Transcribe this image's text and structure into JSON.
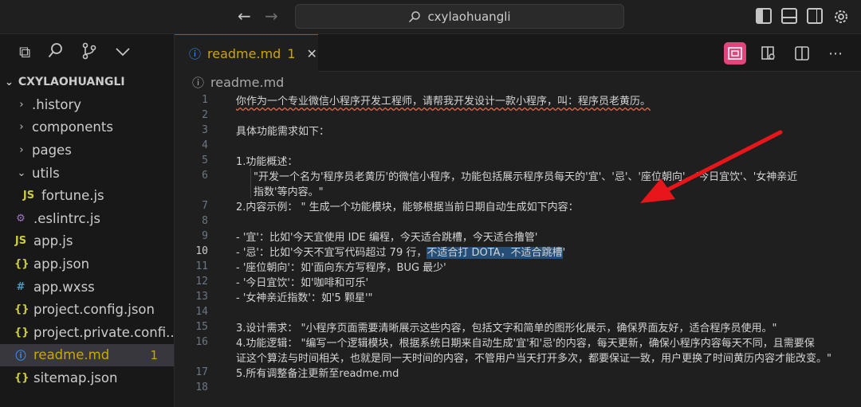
{
  "search": {
    "text": "cxylaohuangli"
  },
  "explorer": {
    "title": "CXYLAOHUANGLI",
    "items": [
      {
        "label": ".history",
        "icon": "",
        "kind": "folder",
        "chev": "›",
        "indent": 1
      },
      {
        "label": "components",
        "icon": "",
        "kind": "folder",
        "chev": "›",
        "indent": 1
      },
      {
        "label": "pages",
        "icon": "",
        "kind": "folder",
        "chev": "›",
        "indent": 1
      },
      {
        "label": "utils",
        "icon": "",
        "kind": "folder",
        "chev": "⌄",
        "indent": 1
      },
      {
        "label": "fortune.js",
        "icon": "JS",
        "kind": "file",
        "indent": 2
      },
      {
        "label": ".eslintrc.js",
        "icon": "⚙",
        "kind": "file",
        "indent": 1
      },
      {
        "label": "app.js",
        "icon": "JS",
        "kind": "file",
        "indent": 1
      },
      {
        "label": "app.json",
        "icon": "{}",
        "kind": "file",
        "indent": 1
      },
      {
        "label": "app.wxss",
        "icon": "#",
        "kind": "file",
        "indent": 1
      },
      {
        "label": "project.config.json",
        "icon": "{}",
        "kind": "file",
        "indent": 1
      },
      {
        "label": "project.private.confi...",
        "icon": "{}",
        "kind": "file",
        "indent": 1
      },
      {
        "label": "readme.md",
        "icon": "ⓘ",
        "kind": "file",
        "indent": 1,
        "selected": true,
        "badge": "1"
      },
      {
        "label": "sitemap.json",
        "icon": "{}",
        "kind": "file",
        "indent": 1
      }
    ]
  },
  "tab": {
    "label": "readme.md",
    "badge": "1"
  },
  "breadcrumb": {
    "file": "readme.md"
  },
  "editor": {
    "lines": [
      {
        "n": "1",
        "text": "你作为一个专业微信小程序开发工程师，请帮我开发设计一款小程序，叫：程序员老黄历。",
        "squig": true
      },
      {
        "n": "2",
        "text": ""
      },
      {
        "n": "3",
        "text": "具体功能需求如下："
      },
      {
        "n": "4",
        "text": ""
      },
      {
        "n": "5",
        "text": "1.功能概述："
      },
      {
        "n": "6",
        "text": "\"开发一个名为'程序员老黄历'的微信小程序，功能包括展示程序员每天的'宜'、'忌'、'座位朝向'、'今日宜饮'、'女神亲近",
        "indent": true
      },
      {
        "n": "",
        "text": "指数'等内容。\"",
        "indent": true
      },
      {
        "n": "7",
        "text": "2.内容示例：  \" 生成一个功能模块，能够根据当前日期自动生成如下内容："
      },
      {
        "n": "8",
        "text": ""
      },
      {
        "n": "9",
        "text": "- '宜'：比如'今天宜使用 IDE 编程，今天适合跳槽，今天适合撸管'"
      },
      {
        "n": "10",
        "text": "- '忌'：比如'今天不宜写代码超过 79 行，",
        "hl": "不适合打 DOTA，不适合跳槽",
        "after": "'",
        "current": true
      },
      {
        "n": "11",
        "text": "- '座位朝向'：如'面向东方写程序，BUG 最少'"
      },
      {
        "n": "12",
        "text": "- '今日宜饮'：如'咖啡和可乐'"
      },
      {
        "n": "13",
        "text": "- '女神亲近指数'：如'5 颗星'\""
      },
      {
        "n": "14",
        "text": ""
      },
      {
        "n": "15",
        "text": "3.设计需求：  \"小程序页面需要清晰展示这些内容，包括文字和简单的图形化展示，确保界面友好，适合程序员使用。\""
      },
      {
        "n": "16",
        "text": "4.功能逻辑：  \"编写一个逻辑模块，根据系统日期来自动生成'宜'和'忌'的内容，每天更新，确保小程序内容每天不同，且需要保"
      },
      {
        "n": "",
        "text": "证这个算法与时间相关，也就是同一天时间的内容，不管用户当天打开多次，都要保证一致，用户更换了时间黄历内容才能改变。\""
      },
      {
        "n": "17",
        "text": "5.所有调整备注更新至readme.md"
      },
      {
        "n": "18",
        "text": ""
      }
    ]
  },
  "colors": {
    "accent": "#0078d4",
    "warning": "#cca700",
    "highlight": "#264f78",
    "arrow": "#e8161b"
  }
}
